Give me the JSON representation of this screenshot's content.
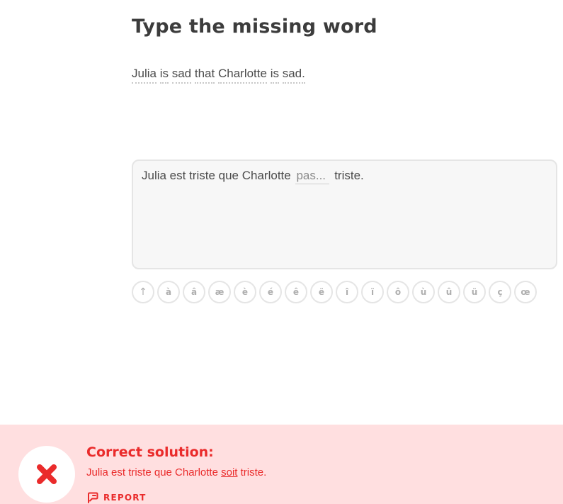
{
  "header": {
    "title": "Type the missing word"
  },
  "prompt": {
    "words": [
      "Julia",
      "is",
      "sad",
      "that",
      "Charlotte",
      "is",
      "sad."
    ]
  },
  "answer": {
    "before": "Julia est triste que Charlotte",
    "typed": "pas...",
    "after": "triste."
  },
  "keyboard": {
    "keys": [
      "↑",
      "à",
      "â",
      "æ",
      "è",
      "é",
      "ê",
      "ë",
      "î",
      "ï",
      "ô",
      "ù",
      "û",
      "ü",
      "ç",
      "œ"
    ]
  },
  "feedback": {
    "title": "Correct solution:",
    "solution_before": "Julia est triste que Charlotte",
    "solution_highlight": "soit",
    "solution_after": "triste.",
    "report_label": "REPORT",
    "icon": "x-mark-icon",
    "color": "#ea2b2b",
    "background": "#ffdfe0"
  }
}
